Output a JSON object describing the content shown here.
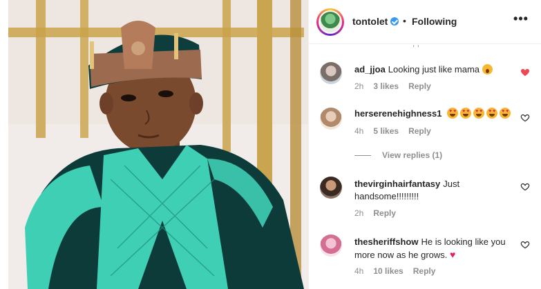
{
  "post": {
    "username": "tontolet",
    "follow_status": "Following",
    "separator": "•",
    "more_label": "•••"
  },
  "comments": [
    {
      "username": "ad_jjoa",
      "text": "Looking just like mama",
      "emoji": "astonished-face",
      "time": "2h",
      "likes": "3 likes",
      "reply_label": "Reply",
      "liked": true
    },
    {
      "username": "herserenehighness1",
      "text": "",
      "emoji": "heart-eyes-face x5",
      "time": "4h",
      "likes": "5 likes",
      "reply_label": "Reply",
      "view_replies": "View replies (1)",
      "liked": false
    },
    {
      "username": "thevirginhairfantasy",
      "text": "Just handsome!!!!!!!!!",
      "time": "2h",
      "likes": "",
      "reply_label": "Reply",
      "liked": false
    },
    {
      "username": "thesheriffshow",
      "text": "He is looking like you more now as he grows.",
      "emoji": "red-heart",
      "time": "4h",
      "likes": "10 likes",
      "reply_label": "Reply",
      "liked": false
    }
  ],
  "colors": {
    "liked_heart": "#ed4956",
    "meta_text": "#8e8e8e",
    "verified_badge": "#3897f0",
    "outfit_teal": "#3fcfb5",
    "outfit_velvet": "#0d3b3a"
  }
}
